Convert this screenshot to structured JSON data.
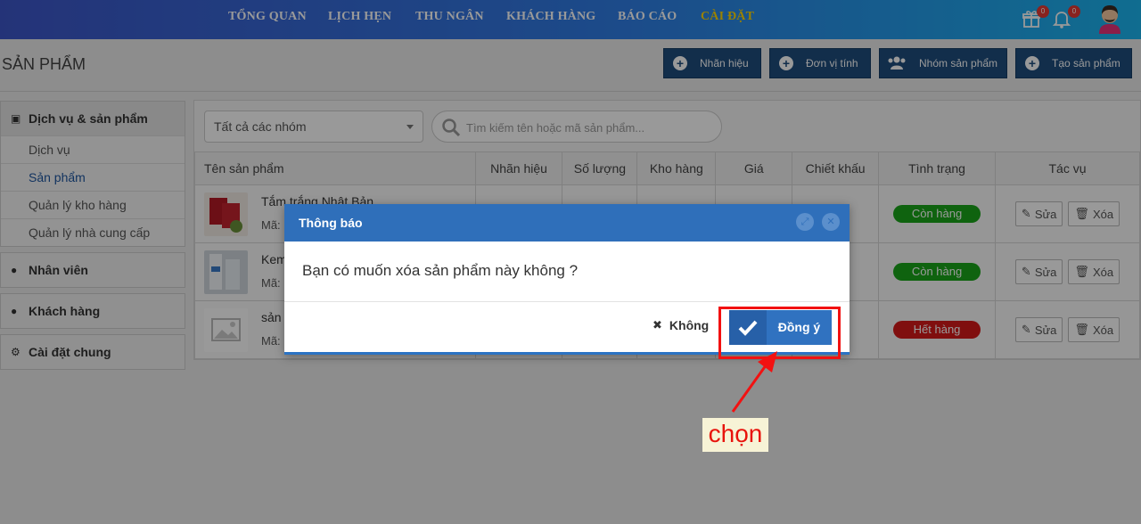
{
  "nav": {
    "items": [
      "TỔNG QUAN",
      "LỊCH HẸN",
      "THU NGÂN",
      "KHÁCH HÀNG",
      "BÁO CÁO",
      "CÀI ĐẶT"
    ],
    "active": "CÀI ĐẶT",
    "gift_badge": "0",
    "bell_badge": "0",
    "icons": [
      "gift-icon",
      "bell-icon",
      "avatar"
    ]
  },
  "header": {
    "title": "SẢN PHẨM",
    "buttons": [
      "Nhãn hiệu",
      "Đơn vị tính",
      "Nhóm sản phẩm",
      "Tạo sản phẩm"
    ]
  },
  "sidebar": {
    "sections": [
      {
        "label": "Dịch vụ & sản phẩm",
        "icon": "cube-icon",
        "items": [
          "Dịch vụ",
          "Sản phẩm",
          "Quản lý kho hàng",
          "Quản lý nhà cung cấp"
        ],
        "active_item": "Sản phẩm"
      },
      {
        "label": "Nhân viên",
        "icon": "user-icon"
      },
      {
        "label": "Khách hàng",
        "icon": "users-icon"
      },
      {
        "label": "Cài đặt chung",
        "icon": "gear-icon"
      }
    ]
  },
  "filters": {
    "group_select": "Tất cả các nhóm",
    "search_placeholder": "Tìm kiếm tên hoặc mã sản phẩm..."
  },
  "table": {
    "columns": [
      "Tên sản phẩm",
      "Nhãn hiệu",
      "Số lượng",
      "Kho hàng",
      "Giá",
      "Chiết khấu",
      "Tình trạng",
      "Tác vụ"
    ],
    "rows": [
      {
        "name": "Tắm trắng Nhật Bản",
        "code": "Mã:",
        "status": "Còn hàng",
        "in_stock": true
      },
      {
        "name": "Kem",
        "code": "Mã:",
        "status": "Còn hàng",
        "in_stock": true
      },
      {
        "name": "sản",
        "code": "Mã:",
        "status": "Hết hàng",
        "in_stock": false
      }
    ],
    "edit_label": "Sửa",
    "delete_label": "Xóa"
  },
  "dialog": {
    "title": "Thông báo",
    "message": "Bạn có muốn xóa sản phẩm này không ?",
    "cancel_label": "Không",
    "confirm_label": "Đồng ý"
  },
  "annotation": {
    "label": "chọn",
    "color": "#f21111"
  }
}
